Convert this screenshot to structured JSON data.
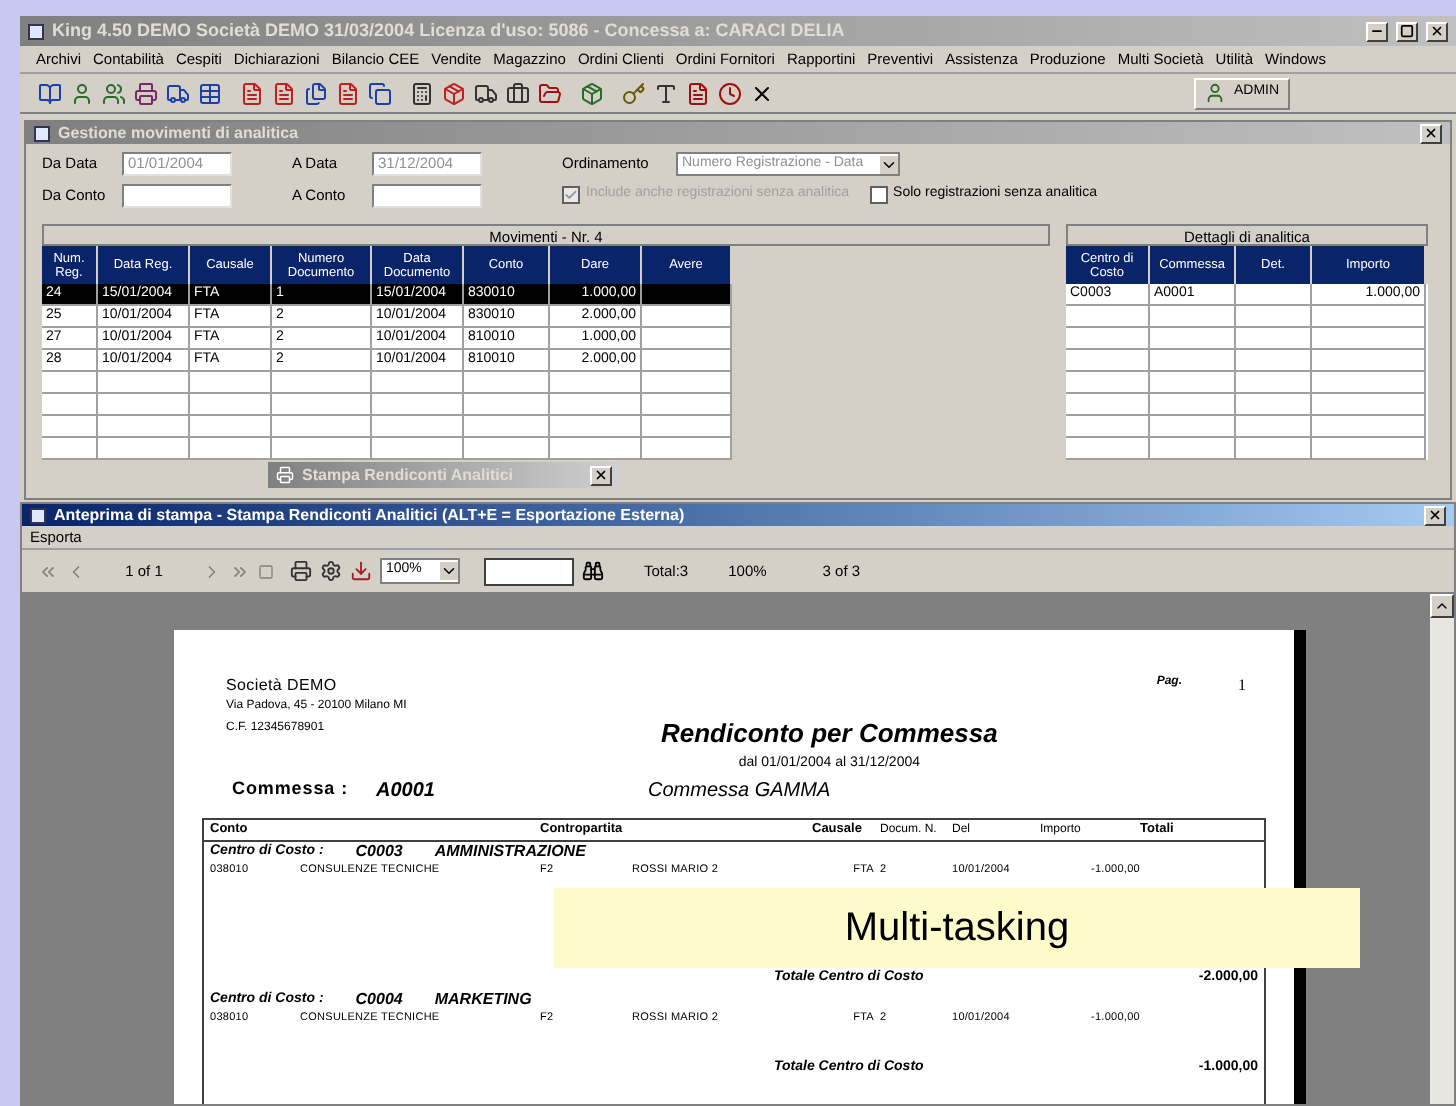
{
  "app_window": {
    "title": "King 4.50   DEMO   Società DEMO 31/03/2004   Licenza d'uso: 5086 - Concessa a: CARACI DELIA",
    "active": false,
    "menu": [
      "Archivi",
      "Contabilità",
      "Cespiti",
      "Dichiarazioni",
      "Bilancio CEE",
      "Vendite",
      "Magazzino",
      "Ordini Clienti",
      "Ordini Fornitori",
      "Rapportini",
      "Preventivi",
      "Assistenza",
      "Produzione",
      "Multi Società",
      "Utilità",
      "Windows"
    ],
    "user_button": "ADMIN"
  },
  "movements_window": {
    "title": "Gestione movimenti di analitica",
    "active": false,
    "filters": [
      {
        "label": "Da Data",
        "value": "01/01/2004"
      },
      {
        "label": "A Data",
        "value": "31/12/2004"
      },
      {
        "label": "Da Conto"
      },
      {
        "label": "A Conto"
      }
    ],
    "ordering": {
      "label": "Ordinamento",
      "value": "Numero Registrazione - Data"
    },
    "checkboxes": [
      {
        "label": "Include anche registrazioni senza analitica",
        "checked": true,
        "disabled": true
      },
      {
        "label": "Solo registrazioni senza analitica",
        "checked": false,
        "disabled": false
      }
    ],
    "movements_grid": {
      "title": "Movimenti - Nr. 4",
      "columns": [
        "Num. Reg.",
        "Data Reg.",
        "Causale",
        "Numero Documento",
        "Data Documento",
        "Conto",
        "Dare",
        "Avere"
      ],
      "rows": [
        {
          "cells": [
            "24",
            "15/01/2004",
            "FTA",
            "1",
            "15/01/2004",
            "830010",
            "1.000,00",
            ""
          ],
          "selected": true
        },
        {
          "cells": [
            "25",
            "10/01/2004",
            "FTA",
            "2",
            "10/01/2004",
            "830010",
            "2.000,00",
            ""
          ],
          "selected": false
        },
        {
          "cells": [
            "27",
            "10/01/2004",
            "FTA",
            "2",
            "10/01/2004",
            "810010",
            "1.000,00",
            ""
          ],
          "selected": false
        },
        {
          "cells": [
            "28",
            "10/01/2004",
            "FTA",
            "2",
            "10/01/2004",
            "810010",
            "2.000,00",
            ""
          ],
          "selected": false
        }
      ]
    },
    "details_grid": {
      "title": "Dettagli di analitica",
      "columns": [
        "Centro di Costo",
        "Commessa",
        "Det.",
        "Importo"
      ],
      "rows": [
        {
          "cells": [
            "C0003",
            "A0001",
            "",
            "1.000,00"
          ]
        }
      ]
    }
  },
  "minimized_dialog": {
    "title": "Stampa Rendiconti Analitici"
  },
  "preview_window": {
    "title": "Anteprima di stampa - Stampa Rendiconti Analitici (ALT+E = Esportazione Esterna)",
    "active": true,
    "menu": [
      "Esporta"
    ],
    "toolbar": {
      "page": "1 of 1",
      "zoom": "100%",
      "total": "Total:3",
      "percent": "100%",
      "count": "3 of 3"
    },
    "report": {
      "company": "Società DEMO",
      "address": "Via Padova, 45 - 20100 Milano MI",
      "tax_code": "C.F. 12345678901",
      "page_label": "Pag.",
      "page_number": "1",
      "title": "Rendiconto per Commessa",
      "period": "dal 01/01/2004 al 31/12/2004",
      "commessa_label": "Commessa :",
      "commessa_code": "A0001",
      "commessa_name": "Commessa GAMMA",
      "columns": [
        "Conto",
        "Contropartita",
        "Causale",
        "Docum. N.",
        "Del",
        "Importo",
        "Totali"
      ],
      "groups": [
        {
          "label": "Centro di Costo :",
          "code": "C0003",
          "name": "AMMINISTRAZIONE",
          "rows": [
            {
              "conto": "038010",
              "descrizione": "CONSULENZE TECNICHE",
              "contropartita": "F2",
              "nome": "ROSSI MARIO 2",
              "causale": "FTA",
              "numero": "2",
              "del": "10/01/2004",
              "importo": "-1.000,00"
            }
          ],
          "total_label": "Totale Centro di Costo",
          "total": "-2.000,00"
        },
        {
          "label": "Centro di Costo :",
          "code": "C0004",
          "name": "MARKETING",
          "rows": [
            {
              "conto": "038010",
              "descrizione": "CONSULENZE TECNICHE",
              "contropartita": "F2",
              "nome": "ROSSI MARIO 2",
              "causale": "FTA",
              "numero": "2",
              "del": "10/01/2004",
              "importo": "-1.000,00"
            }
          ],
          "total_label": "Totale Centro di Costo",
          "total": "-1.000,00"
        }
      ]
    }
  },
  "caption": "Multi-tasking"
}
